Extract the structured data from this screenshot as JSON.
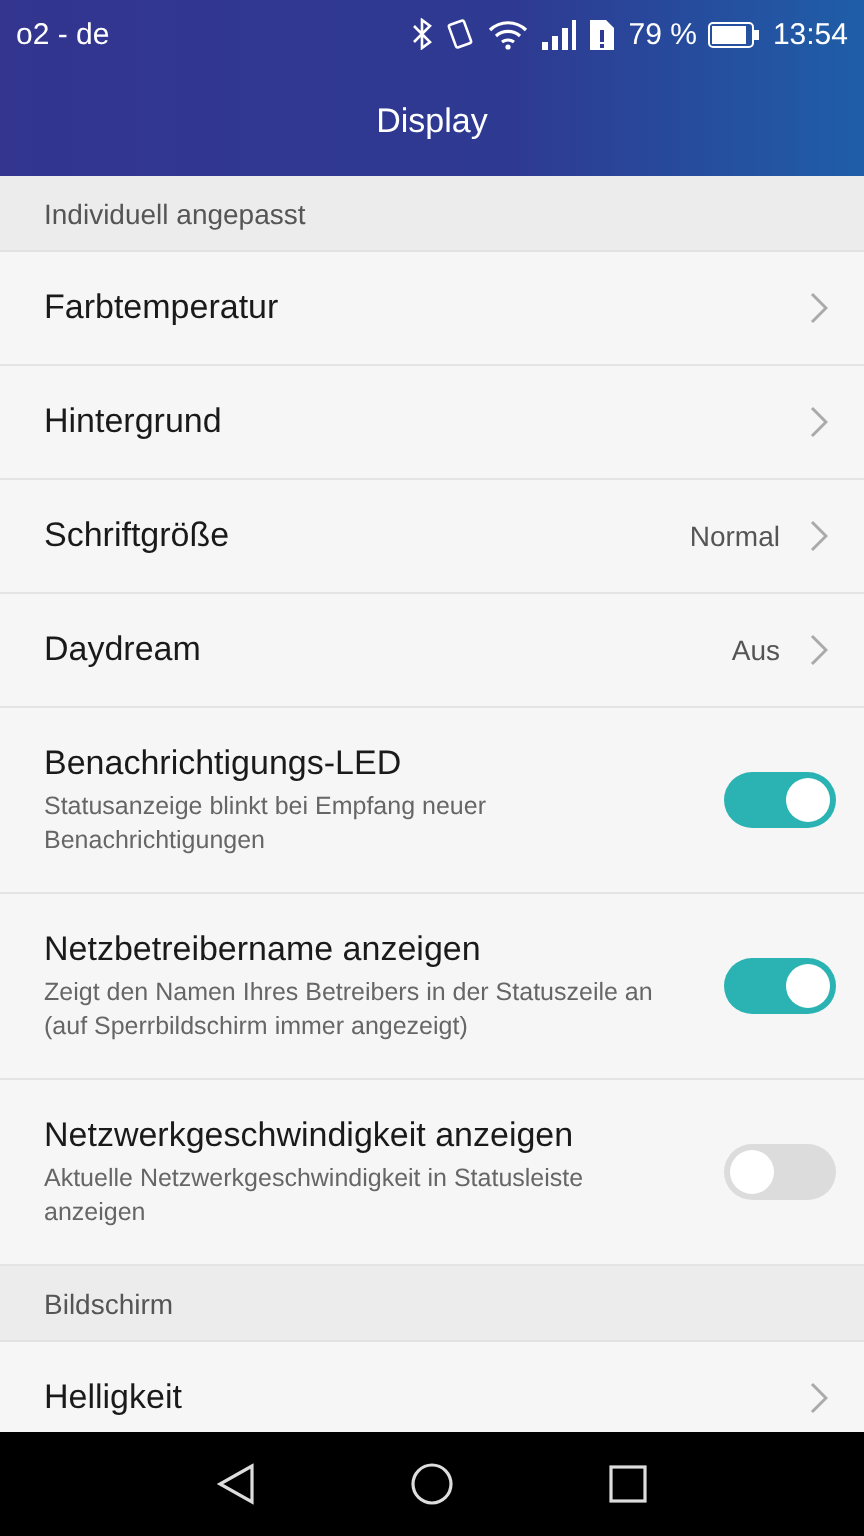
{
  "status_bar": {
    "carrier": "o2 - de",
    "battery": "79 %",
    "time": "13:54"
  },
  "header": {
    "title": "Display"
  },
  "sections": [
    {
      "title": "Individuell angepasst",
      "items": [
        {
          "kind": "nav",
          "label": "Farbtemperatur"
        },
        {
          "kind": "nav",
          "label": "Hintergrund"
        },
        {
          "kind": "nav",
          "label": "Schriftgröße",
          "value": "Normal"
        },
        {
          "kind": "nav",
          "label": "Daydream",
          "value": "Aus"
        },
        {
          "kind": "toggle",
          "label": "Benachrichtigungs-LED",
          "summary": "Statusanzeige blinkt bei Empfang neuer Benachrichtigungen",
          "on": true
        },
        {
          "kind": "toggle",
          "label": "Netzbetreibername anzeigen",
          "summary": "Zeigt den Namen Ihres Betreibers in der Statuszeile an (auf Sperrbildschirm immer angezeigt)",
          "on": true
        },
        {
          "kind": "toggle",
          "label": "Netzwerkgeschwindigkeit anzeigen",
          "summary": "Aktuelle Netzwerkgeschwindigkeit in Statusleiste anzeigen",
          "on": false
        }
      ]
    },
    {
      "title": "Bildschirm",
      "items": [
        {
          "kind": "nav",
          "label": "Helligkeit"
        }
      ]
    }
  ]
}
